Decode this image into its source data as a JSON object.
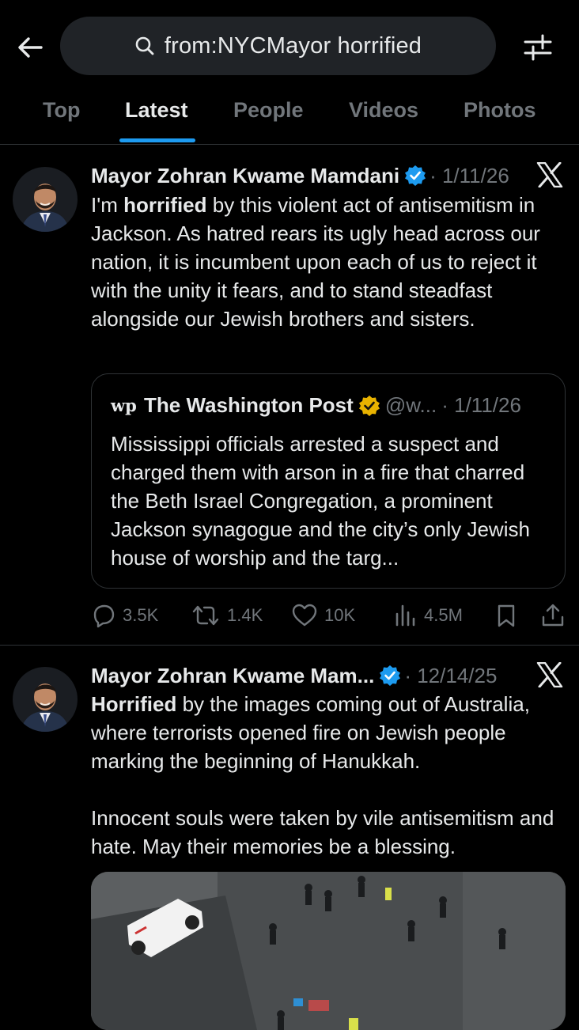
{
  "search": {
    "query": "from:NYCMayor horrified"
  },
  "tabs": [
    {
      "label": "Top"
    },
    {
      "label": "Latest"
    },
    {
      "label": "People"
    },
    {
      "label": "Videos"
    },
    {
      "label": "Photos"
    }
  ],
  "posts": [
    {
      "author": "Mayor Zohran Kwame Mamdani",
      "date": "1/11/26",
      "text_bold": "horrified",
      "text_before": "I'm ",
      "text_after": " by this violent act of antisemitism in Jackson. As hatred rears its ugly head across our nation, it is incumbent upon each of us to reject it with the unity it fears, and to stand steadfast alongside our Jewish brothers and sisters.",
      "quote": {
        "logo": "wp",
        "name": "The Washington Post",
        "handle": "@w...",
        "date": "1/11/26",
        "text": "Mississippi officials arrested a suspect and charged them with arson in a fire that charred the Beth Israel Congregation, a prominent Jackson synagogue and the city’s only Jewish house of worship and the targ..."
      },
      "stats": {
        "replies": "3.5K",
        "reposts": "1.4K",
        "likes": "10K",
        "views": "4.5M"
      }
    },
    {
      "author": "Mayor Zohran Kwame Mam...",
      "date": "12/14/25",
      "text_bold": "Horrified",
      "text_after": " by the images coming out of Australia, where terrorists opened fire on Jewish people marking the beginning of Hanukkah.\n\nInnocent souls were taken by vile antisemitism and hate. May their memories be a blessing."
    }
  ],
  "colors": {
    "accent": "#1d9bf0",
    "verified_gold": "#f4b400",
    "muted": "#71767b"
  },
  "icons": [
    "back-arrow-icon",
    "search-icon",
    "filter-icon",
    "verified-badge-icon",
    "x-logo-icon",
    "reply-icon",
    "repost-icon",
    "like-icon",
    "views-icon",
    "bookmark-icon",
    "share-icon"
  ]
}
